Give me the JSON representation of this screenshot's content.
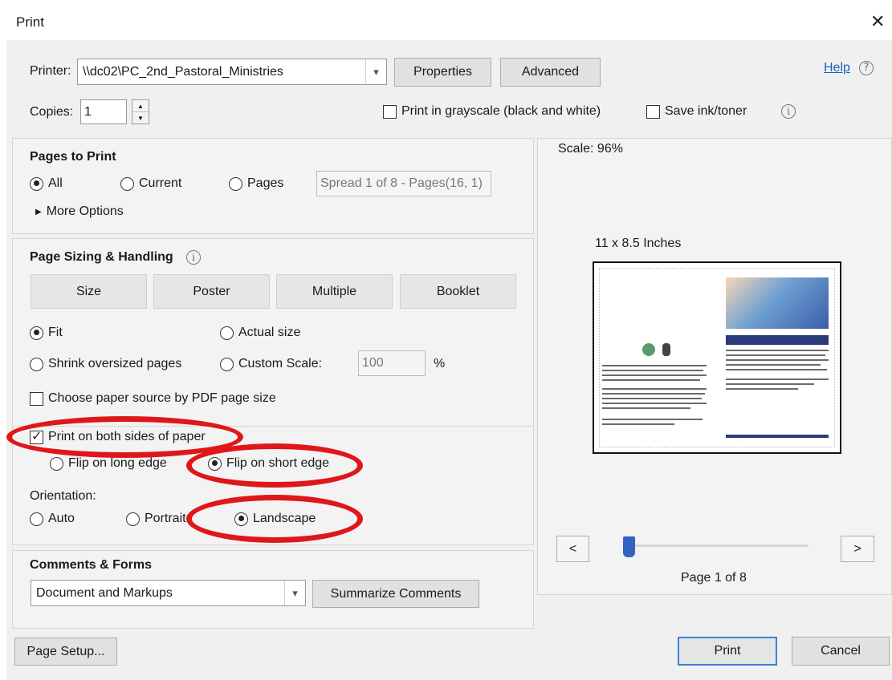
{
  "window": {
    "title": "Print",
    "close": "✕"
  },
  "printer": {
    "label": "Printer:",
    "selected": "\\\\dc02\\PC_2nd_Pastoral_Ministries",
    "properties_button": "Properties",
    "advanced_button": "Advanced",
    "help_link": "Help"
  },
  "copies": {
    "label": "Copies:",
    "value": "1",
    "grayscale_label": "Print in grayscale (black and white)",
    "grayscale_checked": false,
    "save_ink_label": "Save ink/toner",
    "save_ink_checked": false
  },
  "pages_to_print": {
    "heading": "Pages to Print",
    "all_label": "All",
    "current_label": "Current",
    "pages_label": "Pages",
    "pages_field": "Spread 1 of 8 - Pages(16, 1)",
    "selected": "All",
    "more_options": "More Options"
  },
  "sizing": {
    "heading": "Page Sizing & Handling",
    "tabs": [
      "Size",
      "Poster",
      "Multiple",
      "Booklet"
    ],
    "fit_label": "Fit",
    "actual_size_label": "Actual size",
    "shrink_label": "Shrink oversized pages",
    "custom_scale_label": "Custom Scale:",
    "custom_scale_value": "100",
    "percent": "%",
    "paper_source_label": "Choose paper source by PDF page size",
    "both_sides_label": "Print on both sides of paper",
    "both_sides_checked": true,
    "flip_long_label": "Flip on long edge",
    "flip_short_label": "Flip on short edge",
    "orientation_label": "Orientation:",
    "auto_label": "Auto",
    "portrait_label": "Portrait",
    "landscape_label": "Landscape"
  },
  "comments": {
    "heading": "Comments & Forms",
    "selected": "Document and Markups",
    "summarize_button": "Summarize Comments"
  },
  "preview": {
    "scale": "Scale:  96%",
    "paper_size": "11 x 8.5 Inches",
    "page_indicator": "Page 1 of 8",
    "prev": "<",
    "next": ">",
    "slider_position": 0.0
  },
  "footer": {
    "page_setup": "Page Setup...",
    "print": "Print",
    "cancel": "Cancel"
  },
  "colors": {
    "annotation_red": "#e0171a",
    "link_blue": "#1a5fc2",
    "focus_blue": "#3c7fd6"
  }
}
